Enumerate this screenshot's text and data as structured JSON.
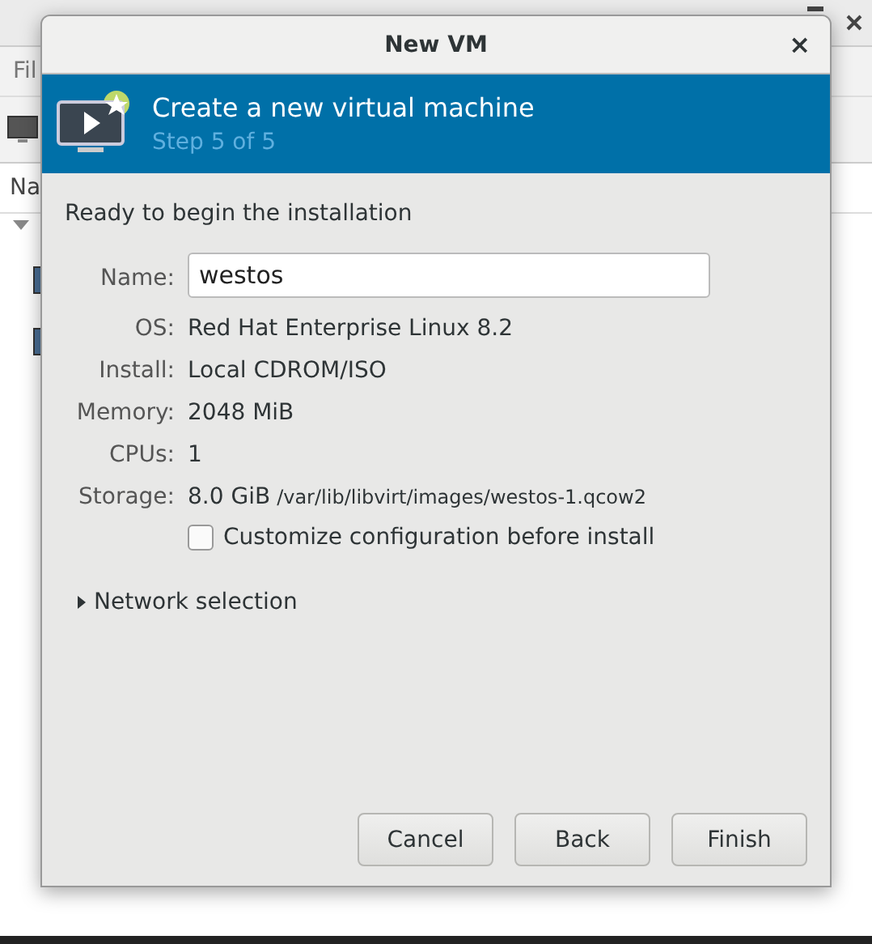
{
  "background_window": {
    "menu_text": "Fil",
    "column_header": "Na"
  },
  "dialog": {
    "title": "New VM",
    "close": "×",
    "header": {
      "title": "Create a new virtual machine",
      "step": "Step 5 of 5"
    },
    "intro": "Ready to begin the installation",
    "name_field": {
      "label": "Name:",
      "value": "westos"
    },
    "details": [
      {
        "label": "OS:",
        "value": "Red Hat Enterprise Linux 8.2"
      },
      {
        "label": "Install:",
        "value": "Local CDROM/ISO"
      },
      {
        "label": "Memory:",
        "value": "2048 MiB"
      },
      {
        "label": "CPUs:",
        "value": "1"
      },
      {
        "label": "Storage:",
        "value": "8.0 GiB",
        "path": "/var/lib/libvirt/images/westos-1.qcow2"
      }
    ],
    "customize": {
      "label": "Customize configuration before install",
      "checked": false
    },
    "network": {
      "label": "Network selection",
      "expanded": false
    },
    "buttons": [
      "Cancel",
      "Back",
      "Finish"
    ]
  }
}
